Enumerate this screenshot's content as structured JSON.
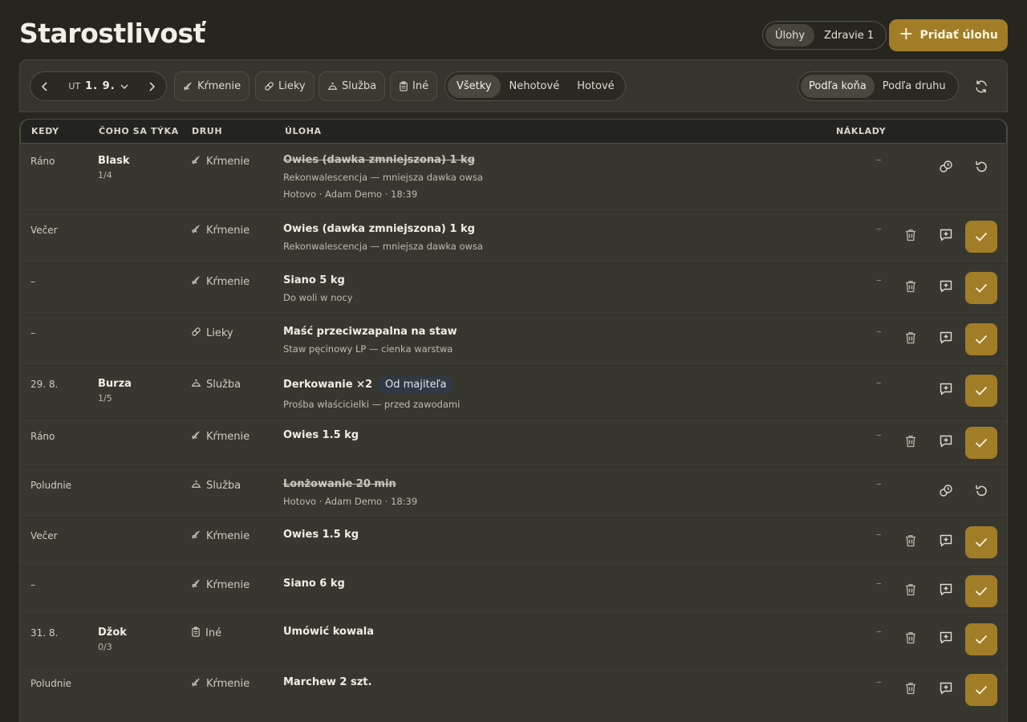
{
  "page": {
    "title": "Starostlivosť"
  },
  "top_tabs": [
    {
      "label": "Úlohy",
      "active": true
    },
    {
      "label": "Zdravie 1",
      "active": false
    }
  ],
  "add_button": {
    "label": "Pridať úlohu"
  },
  "toolbar": {
    "date_dow": "UT",
    "date": "1. 9.",
    "chips": [
      "Kŕmenie",
      "Lieky",
      "Služba",
      "Iné"
    ],
    "filters": [
      {
        "label": "Všetky",
        "active": true
      },
      {
        "label": "Nehotové",
        "active": false
      },
      {
        "label": "Hotové",
        "active": false
      }
    ],
    "grouping": [
      {
        "label": "Podľa koňa",
        "active": true
      },
      {
        "label": "Podľa druhu",
        "active": false
      }
    ]
  },
  "columns": {
    "when": "KEDY",
    "horse": "ČOHO SA TÝKA",
    "kind": "DRUH",
    "task": "ÚLOHA",
    "cost": "NÁKLADY"
  },
  "colors": {
    "accent": "#a17d27",
    "background": "#26261f",
    "panel": "#38372f"
  },
  "rows": [
    {
      "when": "Ráno",
      "horse": "Blask",
      "horse_count": "1/4",
      "kind": "Kŕmenie",
      "icon": "feed-icon",
      "title": "Owies (dawka zmniejszona) 1 kg",
      "sub": "Rekonwalescencja — mniejsza dawka owsa",
      "meta": "Hotovo · Adam Demo · 18:39",
      "cost": "–",
      "done": true
    },
    {
      "when": "Večer",
      "kind": "Kŕmenie",
      "icon": "feed-icon",
      "title": "Owies (dawka zmniejszona) 1 kg",
      "sub": "Rekonwalescencja — mniejsza dawka owsa",
      "cost": "–",
      "done": false
    },
    {
      "when": "–",
      "kind": "Kŕmenie",
      "icon": "feed-icon",
      "title": "Siano 5 kg",
      "sub": "Do woli w nocy",
      "cost": "–",
      "done": false
    },
    {
      "when": "–",
      "kind": "Lieky",
      "icon": "pill-icon",
      "title": "Maść przeciwzapalna na staw",
      "sub": "Staw pęcinowy LP — cienka warstwa",
      "cost": "–",
      "done": false
    },
    {
      "when": "29. 8.",
      "horse": "Burza",
      "horse_count": "1/5",
      "kind": "Služba",
      "icon": "service-bell-icon",
      "title": "Derkowanie ×2",
      "tag": "Od majiteľa",
      "sub": "Prośba właścicielki — przed zawodami",
      "cost": "–",
      "done": false,
      "no_delete": true
    },
    {
      "when": "Ráno",
      "kind": "Kŕmenie",
      "icon": "feed-icon",
      "title": "Owies 1.5 kg",
      "cost": "–",
      "done": false
    },
    {
      "when": "Poludnie",
      "kind": "Služba",
      "icon": "service-bell-icon",
      "title": "Lonżowanie 20 min",
      "meta": "Hotovo · Adam Demo · 18:39",
      "cost": "–",
      "done": true
    },
    {
      "when": "Večer",
      "kind": "Kŕmenie",
      "icon": "feed-icon",
      "title": "Owies 1.5 kg",
      "cost": "–",
      "done": false
    },
    {
      "when": "–",
      "kind": "Kŕmenie",
      "icon": "feed-icon",
      "title": "Siano 6 kg",
      "cost": "–",
      "done": false
    },
    {
      "when": "31. 8.",
      "horse": "Džok",
      "horse_count": "0/3",
      "kind": "Iné",
      "icon": "clipboard-icon",
      "title": "Umówić kowala",
      "cost": "–",
      "done": false
    },
    {
      "when": "Poludnie",
      "kind": "Kŕmenie",
      "icon": "feed-icon",
      "title": "Marchew 2 szt.",
      "cost": "–",
      "done": false
    }
  ]
}
